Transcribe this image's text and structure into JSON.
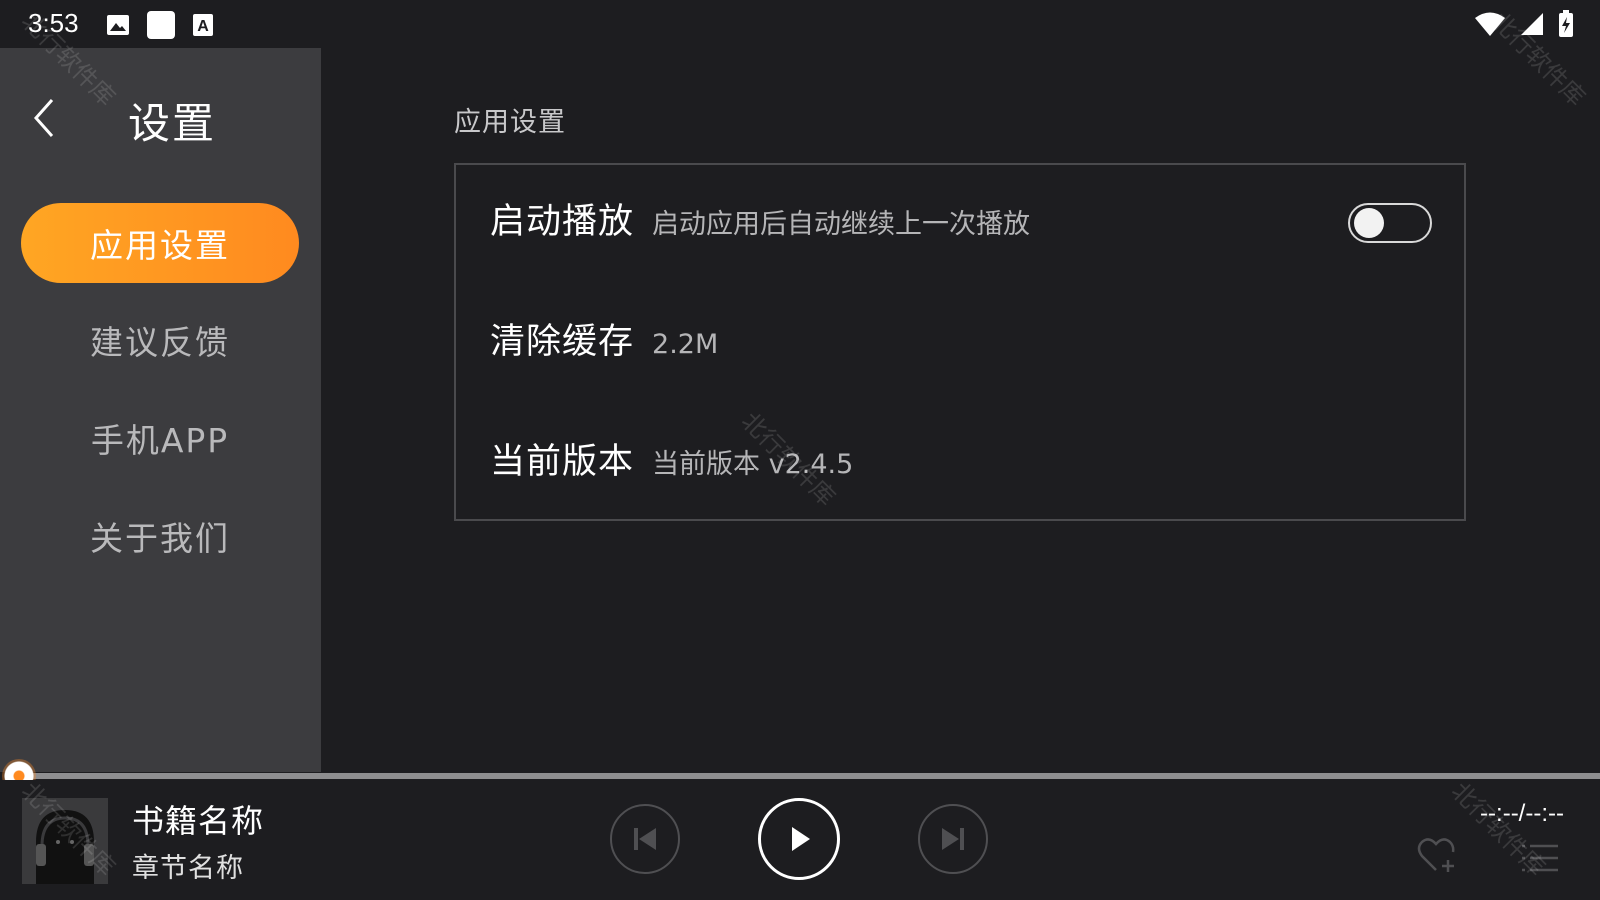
{
  "status_bar": {
    "time": "3:53",
    "left_icons": [
      "image-icon",
      "square-icon",
      "text-a-icon"
    ],
    "right_icons": [
      "wifi-icon",
      "signal-icon",
      "battery-charging-icon"
    ]
  },
  "sidebar": {
    "title": "设置",
    "back_icon": "chevron-left-icon",
    "items": [
      {
        "label": "应用设置",
        "active": true
      },
      {
        "label": "建议反馈",
        "active": false
      },
      {
        "label": "手机APP",
        "active": false
      },
      {
        "label": "关于我们",
        "active": false
      }
    ]
  },
  "main": {
    "section_title": "应用设置",
    "settings": [
      {
        "label": "启动播放",
        "desc": "启动应用后自动继续上一次播放",
        "toggle": false
      },
      {
        "label": "清除缓存",
        "desc": "2.2M"
      },
      {
        "label": "当前版本",
        "desc": "当前版本 v2.4.5"
      }
    ]
  },
  "player": {
    "book_title": "书籍名称",
    "chapter_title": "章节名称",
    "time": "--:--/--:--",
    "progress": 0,
    "controls": [
      "skip-previous-icon",
      "play-icon",
      "skip-next-icon"
    ],
    "actions": [
      "heart-add-icon",
      "playlist-icon"
    ]
  },
  "colors": {
    "accent_start": "#ffa623",
    "accent_end": "#ff8a1f",
    "sidebar_bg": "#3c3c3f",
    "main_bg": "#1d1d20"
  },
  "watermark": "北行软件库"
}
